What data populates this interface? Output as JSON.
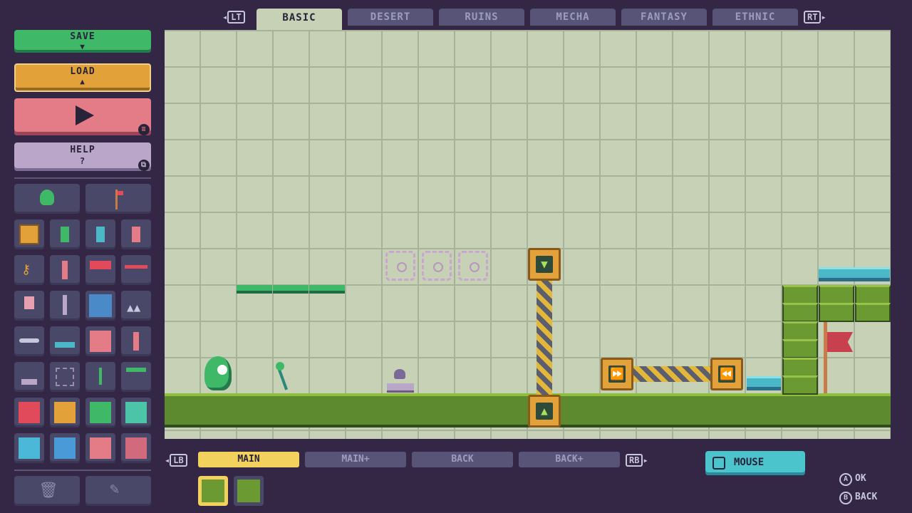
{
  "top_tabs": {
    "lt": "LT",
    "rt": "RT",
    "items": [
      "BASIC",
      "DESERT",
      "RUINS",
      "MECHA",
      "FANTASY",
      "ETHNIC"
    ],
    "active": "BASIC"
  },
  "left_buttons": {
    "save": "SAVE",
    "load": "LOAD",
    "help": "HELP"
  },
  "layer_tabs": {
    "lb": "LB",
    "rb": "RB",
    "items": [
      "MAIN",
      "MAIN+",
      "BACK",
      "BACK+"
    ],
    "active": "MAIN"
  },
  "mouse_label": "MOUSE",
  "hints": {
    "a_key": "A",
    "a_label": "OK",
    "b_key": "B",
    "b_label": "BACK"
  },
  "colors": {
    "grid_bg": "#c6d1b6",
    "ground": "#5e8a2f",
    "accent_save": "#3fb868",
    "accent_load": "#e3a13a",
    "accent_play": "#e37c86",
    "accent_help": "#b9a6c8"
  }
}
